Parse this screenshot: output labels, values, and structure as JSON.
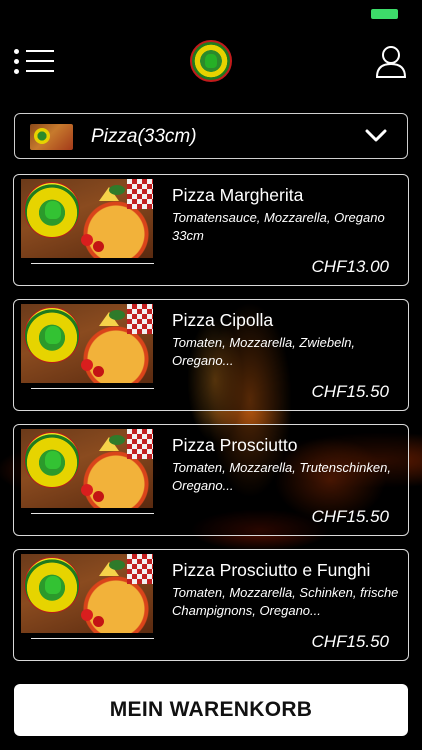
{
  "category": {
    "label": "Pizza(33cm)"
  },
  "items": [
    {
      "title": "Pizza Margherita",
      "description": "Tomatensauce, Mozzarella, Oregano 33cm",
      "price": "CHF13.00"
    },
    {
      "title": "Pizza Cipolla",
      "description": "Tomaten, Mozzarella, Zwiebeln, Oregano...",
      "price": "CHF15.50"
    },
    {
      "title": "Pizza Prosciutto",
      "description": "Tomaten, Mozzarella, Trutenschinken, Oregano...",
      "price": "CHF15.50"
    },
    {
      "title": "Pizza Prosciutto e Funghi",
      "description": "Tomaten, Mozzarella, Schinken, frische Champignons, Oregano...",
      "price": "CHF15.50"
    }
  ],
  "cart": {
    "label": "MEIN WARENKORB"
  },
  "icons": {
    "menu": "menu-icon",
    "user": "user-icon",
    "chevron": "chevron-down-icon",
    "logo": "restaurant-logo"
  },
  "colors": {
    "background": "#000000",
    "battery": "#3ddc6a",
    "cart_button": "#ffffff"
  }
}
